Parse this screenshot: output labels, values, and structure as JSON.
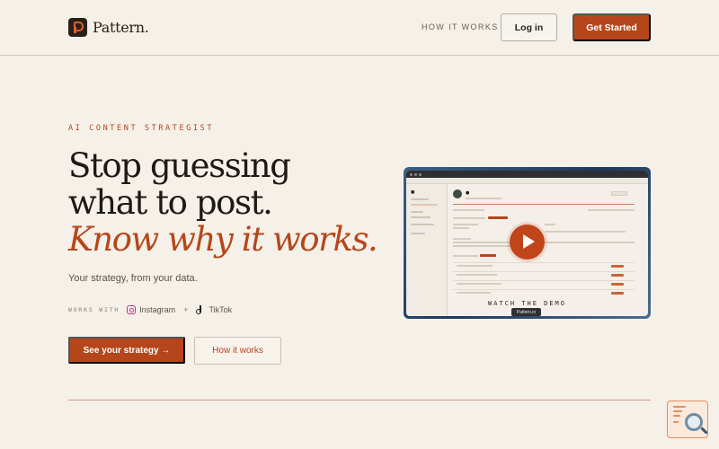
{
  "header": {
    "brand": "Pattern.",
    "nav_link": "HOW IT WORKS",
    "login_label": "Log in",
    "start_label": "Get Started"
  },
  "hero": {
    "eyebrow": "AI CONTENT STRATEGIST",
    "headline_line1": "Stop guessing",
    "headline_line2": "what to post.",
    "headline_accent": "Know why it works.",
    "subtitle": "Your strategy, from your data.",
    "works_with_label": "WORKS WITH",
    "platforms": [
      "Instagram",
      "TikTok"
    ],
    "plus": "+",
    "primary_cta": "See your strategy →",
    "secondary_cta": "How it works"
  },
  "demo": {
    "watch_label": "WATCH THE DEMO",
    "pill_label": "Pattern.io"
  },
  "colors": {
    "background": "#f5f0e8",
    "accent": "#b5461b",
    "text": "#1e1915"
  }
}
